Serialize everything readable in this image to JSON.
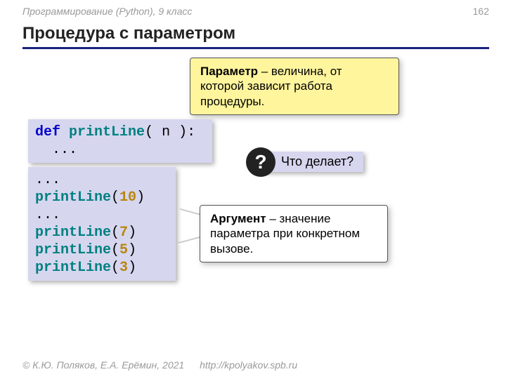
{
  "header": {
    "subtitle": "Программирование (Python), 9 класс",
    "page": "162",
    "title": "Процедура с параметром"
  },
  "callout_param": {
    "bold": "Параметр",
    "rest": " – величина, от которой зависит работа процедуры."
  },
  "code_def": {
    "kw_def": "def",
    "fname": "printLine",
    "sig_open": "( n ):",
    "body": "  ..."
  },
  "code_calls": {
    "e0": "...",
    "f1": "printLine",
    "a1": "(",
    "n1": "10",
    "z1": ")",
    "e1": "...",
    "f2": "printLine",
    "a2": "(",
    "n2": "7",
    "z2": ")",
    "f3": "printLine",
    "a3": "(",
    "n3": "5",
    "z3": ")",
    "f4": "printLine",
    "a4": "(",
    "n4": "3",
    "z4": ")"
  },
  "question": {
    "mark": "?",
    "text": "Что делает?"
  },
  "callout_arg": {
    "bold": "Аргумент",
    "rest": " – значение параметра при конкретном вызове."
  },
  "footer": {
    "copyright": "© К.Ю. Поляков, Е.А. Ерёмин, 2021",
    "url": "http://kpolyakov.spb.ru"
  }
}
